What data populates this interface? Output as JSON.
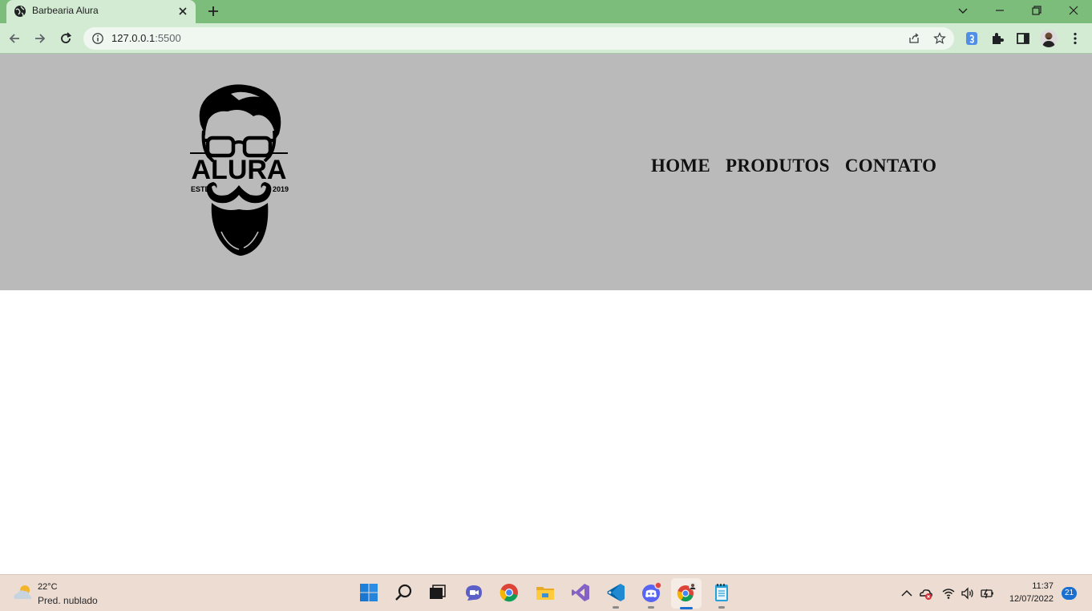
{
  "browser": {
    "tab_title": "Barbearia Alura",
    "url_host": "127.0.0.1",
    "url_port": ":5500",
    "tab_color": "#d2ebd2",
    "frame_color": "#7cbd7c"
  },
  "site": {
    "header_bg": "#bababa",
    "logo": {
      "brand": "ALURA",
      "left_text": "ESTD",
      "right_text": "2019"
    },
    "nav": [
      {
        "label": "HOME"
      },
      {
        "label": "PRODUTOS"
      },
      {
        "label": "CONTATO"
      }
    ]
  },
  "taskbar": {
    "weather_temp": "22°C",
    "weather_desc": "Pred. nublado",
    "time": "11:37",
    "date": "12/07/2022",
    "notifications": "21",
    "apps": [
      "start-icon",
      "search-icon",
      "task-view-icon",
      "teams-chat-icon",
      "chrome-icon",
      "file-explorer-icon",
      "visual-studio-icon",
      "vscode-icon",
      "discord-icon",
      "chrome-profile-icon",
      "notepad-icon"
    ]
  }
}
